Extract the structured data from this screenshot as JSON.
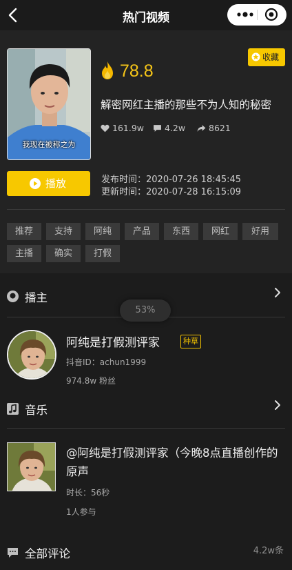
{
  "nav": {
    "title": "热门视频",
    "icons": [
      "back-chevron-icon",
      "more-dots-icon",
      "target-circle-icon"
    ]
  },
  "video": {
    "cover_caption": "我现在被称之为",
    "score": "78.8",
    "title": "解密网红主播的那些不为人知的秘密",
    "favorite_label": "收藏",
    "stats": {
      "likes": "161.9w",
      "comments": "4.2w",
      "shares": "8621"
    },
    "play_label": "播放",
    "publish_time": "发布时间：2020-07-26 18:45:45",
    "update_time": "更新时间：2020-07-28 16:15:09"
  },
  "tags": [
    "推荐",
    "支持",
    "阿纯",
    "产品",
    "东西",
    "网红",
    "好用",
    "主播",
    "确实",
    "打假"
  ],
  "host_section": {
    "heading": "播主",
    "name": "阿纯是打假测评家",
    "badge": "种草",
    "douyin_id": "抖音ID：achun1999",
    "followers": "974.8w 粉丝"
  },
  "loading_toast": "53%",
  "music_section": {
    "heading": "音乐",
    "title": "@阿纯是打假测评家（今晚8点直播创作的原声",
    "duration": "时长：56秒",
    "participants": "1人参与"
  },
  "comments_section": {
    "heading": "全部评论",
    "count": "4.2w条"
  },
  "colors": {
    "accent": "#f7c800",
    "background": "#232323",
    "band": "#1c1c1c",
    "tag_bg": "#3a3a3a"
  }
}
